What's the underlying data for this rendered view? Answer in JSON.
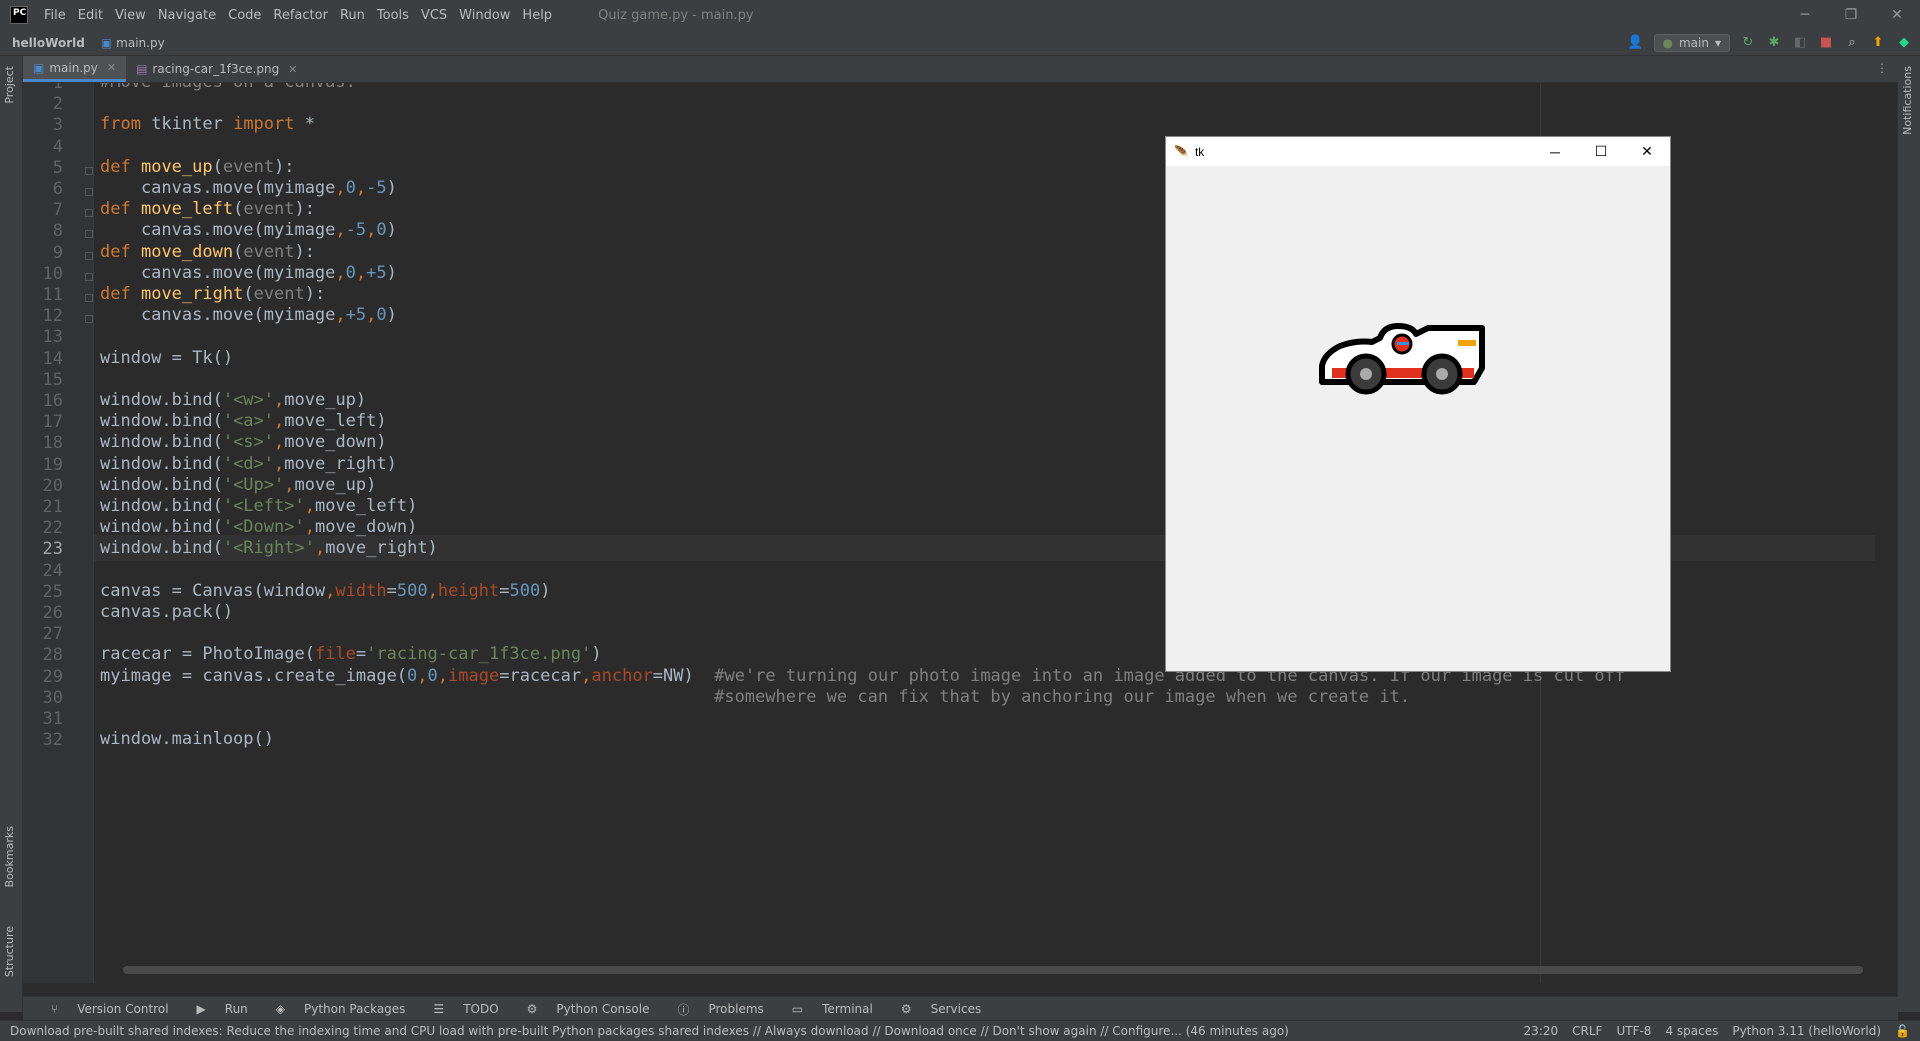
{
  "window": {
    "title": "Quiz game.py - main.py",
    "app_badge": "PC"
  },
  "menu": [
    "File",
    "Edit",
    "View",
    "Navigate",
    "Code",
    "Refactor",
    "Run",
    "Tools",
    "VCS",
    "Window",
    "Help"
  ],
  "nav": {
    "project": "helloWorld",
    "file": "main.py",
    "branch": "main"
  },
  "tabs": [
    {
      "label": "main.py",
      "active": true
    },
    {
      "label": "racing-car_1f3ce.png",
      "active": false
    }
  ],
  "left_strip": {
    "project": "Project",
    "bookmarks": "Bookmarks",
    "structure": "Structure"
  },
  "right_strip": {
    "notifications": "Notifications"
  },
  "editor": {
    "current_line": 23,
    "lines": [
      "#Move images on a canvas:",
      "",
      "from tkinter import *",
      "",
      "def move_up(event):",
      "    canvas.move(myimage,0,-5)",
      "def move_left(event):",
      "    canvas.move(myimage,-5,0)",
      "def move_down(event):",
      "    canvas.move(myimage,0,+5)",
      "def move_right(event):",
      "    canvas.move(myimage,+5,0)",
      "",
      "window = Tk()",
      "",
      "window.bind('<w>',move_up)",
      "window.bind('<a>',move_left)",
      "window.bind('<s>',move_down)",
      "window.bind('<d>',move_right)",
      "window.bind('<Up>',move_up)",
      "window.bind('<Left>',move_left)",
      "window.bind('<Down>',move_down)",
      "window.bind('<Right>',move_right)",
      "",
      "canvas = Canvas(window,width=500,height=500)",
      "canvas.pack()",
      "",
      "racecar = PhotoImage(file='racing-car_1f3ce.png')",
      "myimage = canvas.create_image(0,0,image=racecar,anchor=NW)  #we're turning our photo image into an image added to the canvas. If our image is cut off",
      "                                                            #somewhere we can fix that by anchoring our image when we create it.",
      "",
      "window.mainloop()"
    ]
  },
  "tk_window": {
    "title": "tk"
  },
  "tool_windows": [
    "Version Control",
    "Run",
    "Python Packages",
    "TODO",
    "Python Console",
    "Problems",
    "Terminal",
    "Services"
  ],
  "status": {
    "message": "Download pre-built shared indexes: Reduce the indexing time and CPU load with pre-built Python packages shared indexes // Always download // Download once // Don't show again // Configure... (46 minutes ago)",
    "position": "23:20",
    "line_sep": "CRLF",
    "encoding": "UTF-8",
    "indent": "4 spaces",
    "interpreter": "Python 3.11 (helloWorld)"
  }
}
